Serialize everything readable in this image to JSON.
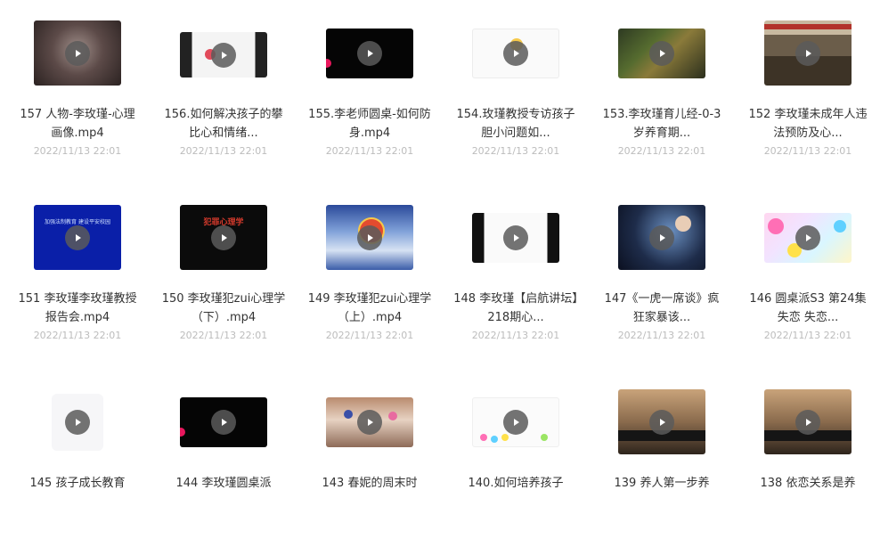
{
  "files": [
    {
      "title": "157 人物-李玫瑾-心理画像.mp4",
      "date": "2022/11/13 22:01"
    },
    {
      "title": "156.如何解决孩子的攀比心和情绪...",
      "date": "2022/11/13 22:01"
    },
    {
      "title": "155.李老师圆桌-如何防身.mp4",
      "date": "2022/11/13 22:01"
    },
    {
      "title": "154.玫瑾教授专访孩子胆小问题如...",
      "date": "2022/11/13 22:01"
    },
    {
      "title": "153.李玫瑾育儿经-0-3岁养育期...",
      "date": "2022/11/13 22:01"
    },
    {
      "title": "152 李玫瑾未成年人违法预防及心...",
      "date": "2022/11/13 22:01"
    },
    {
      "title": "151 李玫瑾李玫瑾教授报告会.mp4",
      "date": "2022/11/13 22:01"
    },
    {
      "title": "150 李玫瑾犯zui心理学（下）.mp4",
      "date": "2022/11/13 22:01"
    },
    {
      "title": "149 李玫瑾犯zui心理学（上）.mp4",
      "date": "2022/11/13 22:01"
    },
    {
      "title": "148 李玫瑾【启航讲坛】218期心...",
      "date": "2022/11/13 22:01"
    },
    {
      "title": "147《一虎一席谈》疯狂家暴该...",
      "date": "2022/11/13 22:01"
    },
    {
      "title": "146 圆桌派S3 第24集 失恋 失恋...",
      "date": "2022/11/13 22:01"
    },
    {
      "title": "145 孩子成长教育",
      "date": ""
    },
    {
      "title": "144 李玫瑾圆桌派",
      "date": ""
    },
    {
      "title": "143 春妮的周末时",
      "date": ""
    },
    {
      "title": "140.如何培养孩子",
      "date": ""
    },
    {
      "title": "139 养人第一步养",
      "date": ""
    },
    {
      "title": "138 依恋关系是养",
      "date": ""
    }
  ],
  "thumb_overlays": {
    "t151_text": "加强法制教育 建设平安校园",
    "t150_text": "犯罪心理学"
  },
  "icons": {
    "play": "play-icon"
  }
}
